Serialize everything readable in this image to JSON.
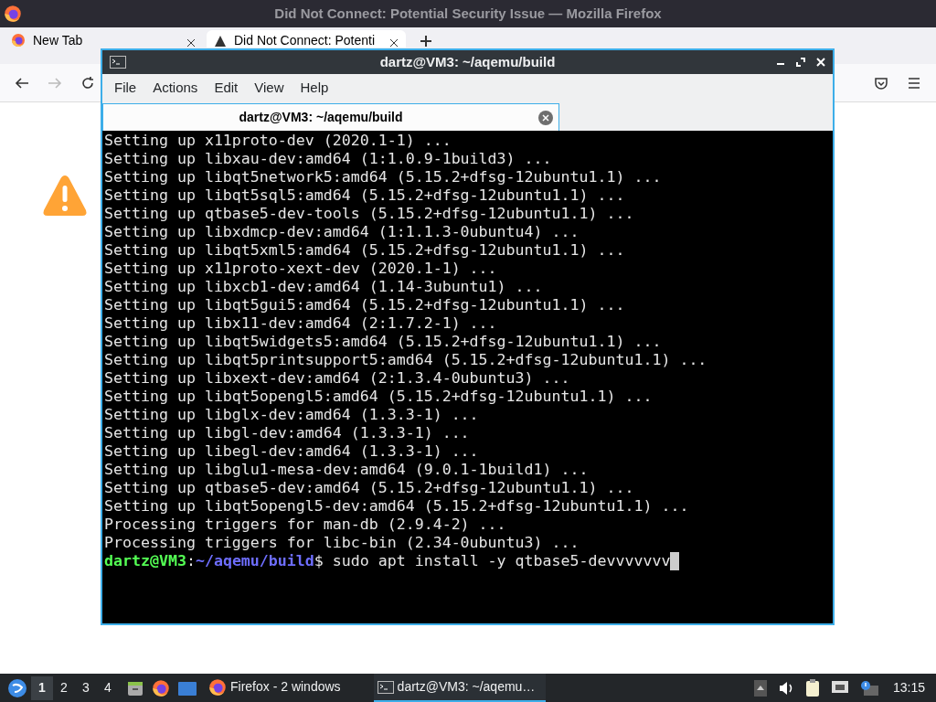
{
  "browser": {
    "title": "Did Not Connect: Potential Security Issue — Mozilla Firefox",
    "tabs": [
      {
        "label": "New Tab",
        "selected": false
      },
      {
        "label": "Did Not Connect: Potenti",
        "selected": true
      }
    ]
  },
  "terminal": {
    "title": "dartz@VM3: ~/aqemu/build",
    "menu": [
      "File",
      "Actions",
      "Edit",
      "View",
      "Help"
    ],
    "tabs": [
      {
        "label": "dartz@VM3: ~/aqemu/build",
        "selected": true
      }
    ],
    "lines": [
      "Setting up x11proto-dev (2020.1-1) ...",
      "Setting up libxau-dev:amd64 (1:1.0.9-1build3) ...",
      "Setting up libqt5network5:amd64 (5.15.2+dfsg-12ubuntu1.1) ...",
      "Setting up libqt5sql5:amd64 (5.15.2+dfsg-12ubuntu1.1) ...",
      "Setting up qtbase5-dev-tools (5.15.2+dfsg-12ubuntu1.1) ...",
      "Setting up libxdmcp-dev:amd64 (1:1.1.3-0ubuntu4) ...",
      "Setting up libqt5xml5:amd64 (5.15.2+dfsg-12ubuntu1.1) ...",
      "Setting up x11proto-xext-dev (2020.1-1) ...",
      "Setting up libxcb1-dev:amd64 (1.14-3ubuntu1) ...",
      "Setting up libqt5gui5:amd64 (5.15.2+dfsg-12ubuntu1.1) ...",
      "Setting up libx11-dev:amd64 (2:1.7.2-1) ...",
      "Setting up libqt5widgets5:amd64 (5.15.2+dfsg-12ubuntu1.1) ...",
      "Setting up libqt5printsupport5:amd64 (5.15.2+dfsg-12ubuntu1.1) ...",
      "Setting up libxext-dev:amd64 (2:1.3.4-0ubuntu3) ...",
      "Setting up libqt5opengl5:amd64 (5.15.2+dfsg-12ubuntu1.1) ...",
      "Setting up libglx-dev:amd64 (1.3.3-1) ...",
      "Setting up libgl-dev:amd64 (1.3.3-1) ...",
      "Setting up libegl-dev:amd64 (1.3.3-1) ...",
      "Setting up libglu1-mesa-dev:amd64 (9.0.1-1build1) ...",
      "Setting up qtbase5-dev:amd64 (5.15.2+dfsg-12ubuntu1.1) ...",
      "Setting up libqt5opengl5-dev:amd64 (5.15.2+dfsg-12ubuntu1.1) ...",
      "Processing triggers for man-db (2.9.4-2) ...",
      "Processing triggers for libc-bin (2.34-0ubuntu3) ..."
    ],
    "prompt": {
      "user_host": "dartz@VM3",
      "separator": ":",
      "path": "~/aqemu/build",
      "command": "$ sudo apt install -y qtbase5-devvvvvvv"
    }
  },
  "taskbar": {
    "workspaces": [
      {
        "label": "1",
        "selected": true
      },
      {
        "label": "2",
        "selected": false
      },
      {
        "label": "3",
        "selected": false
      },
      {
        "label": "4",
        "selected": false
      }
    ],
    "tasks": [
      {
        "kind": "firefox",
        "label": "Firefox - 2 windows",
        "selected": false
      },
      {
        "kind": "terminal",
        "label": "dartz@VM3: ~/aqemu…",
        "selected": true
      }
    ],
    "clock": "13:15"
  }
}
